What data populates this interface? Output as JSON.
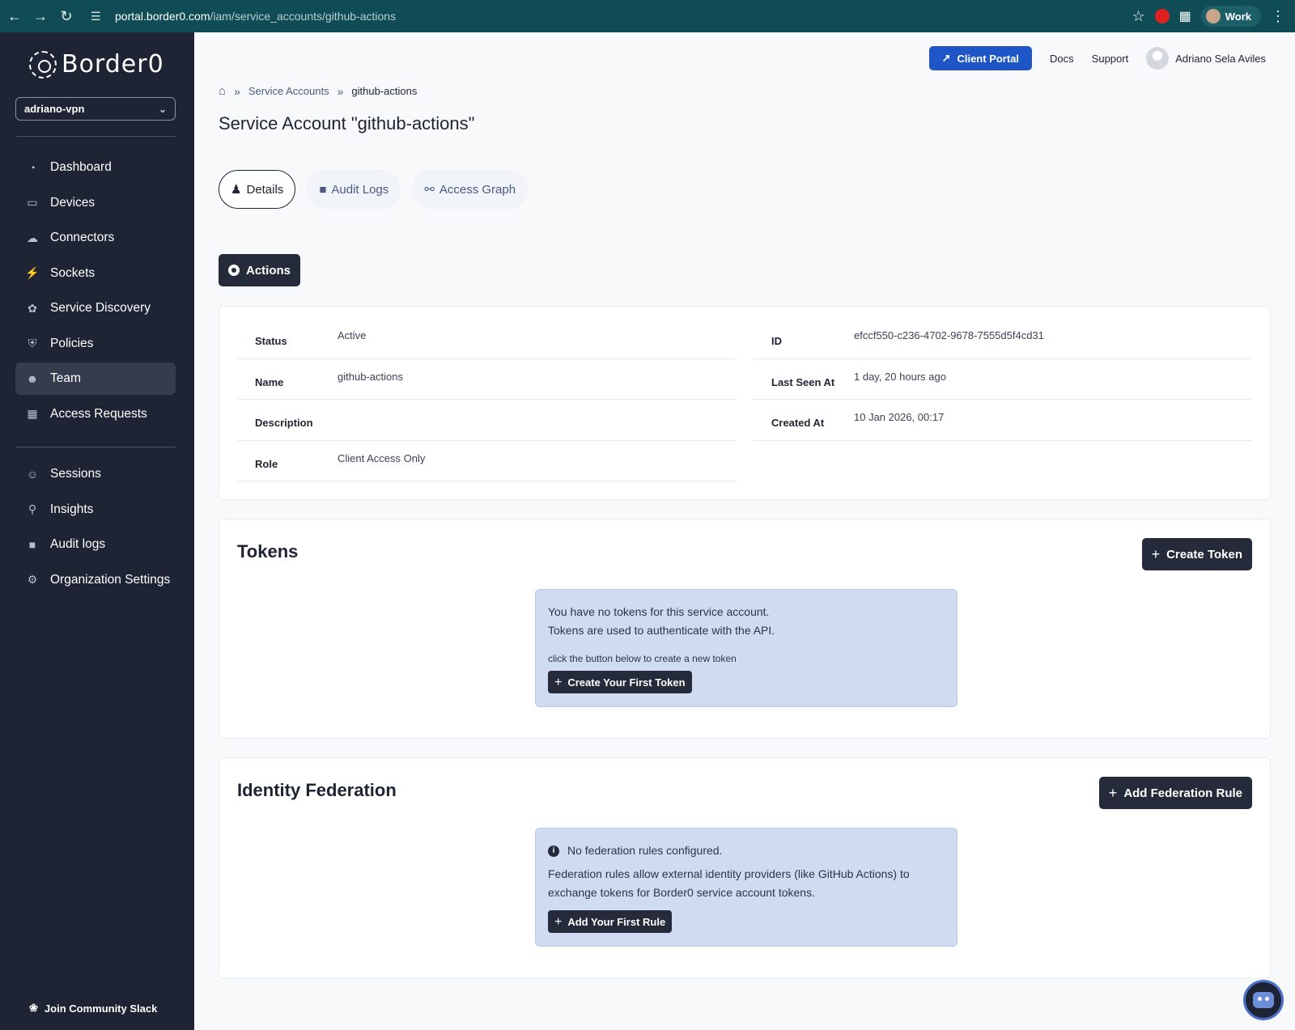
{
  "browser": {
    "url_host": "portal.border0.com",
    "url_path": "/iam/service_accounts/github-actions",
    "profile_label": "Work"
  },
  "sidebar": {
    "logo_text": "Border0",
    "org": "adriano-vpn",
    "items": [
      {
        "label": "Dashboard",
        "icon": "pie-chart-icon"
      },
      {
        "label": "Devices",
        "icon": "monitor-icon"
      },
      {
        "label": "Connectors",
        "icon": "cloud-icon"
      },
      {
        "label": "Sockets",
        "icon": "plug-icon"
      },
      {
        "label": "Service Discovery",
        "icon": "satellite-icon"
      },
      {
        "label": "Policies",
        "icon": "shield-icon"
      },
      {
        "label": "Team",
        "icon": "users-icon",
        "active": true
      },
      {
        "label": "Access Requests",
        "icon": "calendar-icon"
      }
    ],
    "items2": [
      {
        "label": "Sessions",
        "icon": "user-clock-icon"
      },
      {
        "label": "Insights",
        "icon": "magnifier-icon"
      },
      {
        "label": "Audit logs",
        "icon": "folder-icon"
      },
      {
        "label": "Organization Settings",
        "icon": "gear-icon"
      }
    ],
    "footer": "Join Community Slack"
  },
  "header": {
    "client_portal": "Client Portal",
    "docs": "Docs",
    "support": "Support",
    "user_name": "Adriano Sela Aviles"
  },
  "breadcrumb": {
    "parent": "Service Accounts",
    "current": "github-actions"
  },
  "page_title": "Service Account \"github-actions\"",
  "tabs": [
    {
      "label": "Details",
      "active": true
    },
    {
      "label": "Audit Logs"
    },
    {
      "label": "Access Graph"
    }
  ],
  "actions_label": "Actions",
  "details": {
    "left": [
      {
        "key": "Status",
        "value": "Active"
      },
      {
        "key": "Name",
        "value": "github-actions"
      },
      {
        "key": "Description",
        "value": ""
      },
      {
        "key": "Role",
        "value": "Client Access Only"
      }
    ],
    "right": [
      {
        "key": "ID",
        "value": "efccf550-c236-4702-9678-7555d5f4cd31"
      },
      {
        "key": "Last Seen At",
        "value": "1 day, 20 hours ago"
      },
      {
        "key": "Created At",
        "value": "10 Jan 2026, 00:17"
      }
    ]
  },
  "tokens": {
    "title": "Tokens",
    "create_button": "Create Token",
    "empty_line1": "You have no tokens for this service account.",
    "empty_line2": "Tokens are used to authenticate with the API.",
    "hint": "click the button below to create a new token",
    "first_button": "Create Your First Token"
  },
  "federation": {
    "title": "Identity Federation",
    "add_button": "Add Federation Rule",
    "empty_title": "No federation rules configured.",
    "empty_body": "Federation rules allow external identity providers (like GitHub Actions) to exchange tokens for Border0 service account tokens.",
    "first_button": "Add Your First Rule"
  }
}
